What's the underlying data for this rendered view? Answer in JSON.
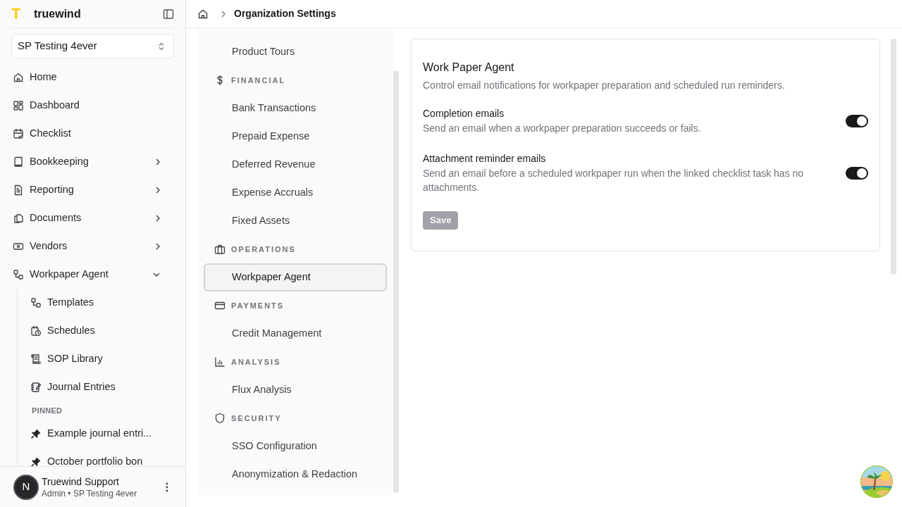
{
  "sidebar": {
    "logo": "T",
    "brand": "truewind",
    "org_selector": {
      "value": "SP Testing 4ever"
    },
    "nav": [
      {
        "label": "Home"
      },
      {
        "label": "Dashboard"
      },
      {
        "label": "Checklist"
      },
      {
        "label": "Bookkeeping",
        "expanded": false
      },
      {
        "label": "Reporting",
        "expanded": false
      },
      {
        "label": "Documents",
        "expanded": false
      },
      {
        "label": "Vendors",
        "expanded": false
      },
      {
        "label": "Workpaper Agent",
        "expanded": true,
        "children": [
          {
            "label": "Templates"
          },
          {
            "label": "Schedules"
          },
          {
            "label": "SOP Library"
          },
          {
            "label": "Journal Entries"
          }
        ]
      }
    ],
    "pinned_title": "PINNED",
    "pinned": [
      {
        "label": "Example journal entri..."
      },
      {
        "label": "October portfolio bon"
      }
    ],
    "user": {
      "initial": "N",
      "name": "Truewind Support",
      "role": "Admin • SP Testing 4ever"
    }
  },
  "breadcrumb": {
    "current": "Organization Settings"
  },
  "settings_nav": [
    {
      "items": [
        {
          "label": "Product Tours",
          "selected": false
        }
      ]
    },
    {
      "title": "FINANCIAL",
      "items": [
        {
          "label": "Bank Transactions",
          "selected": false
        },
        {
          "label": "Prepaid Expense",
          "selected": false
        },
        {
          "label": "Deferred Revenue",
          "selected": false
        },
        {
          "label": "Expense Accruals",
          "selected": false
        },
        {
          "label": "Fixed Assets",
          "selected": false
        }
      ]
    },
    {
      "title": "OPERATIONS",
      "items": [
        {
          "label": "Workpaper Agent",
          "selected": true
        }
      ]
    },
    {
      "title": "PAYMENTS",
      "items": [
        {
          "label": "Credit Management",
          "selected": false
        }
      ]
    },
    {
      "title": "ANALYSIS",
      "items": [
        {
          "label": "Flux Analysis",
          "selected": false
        }
      ]
    },
    {
      "title": "SECURITY",
      "items": [
        {
          "label": "SSO Configuration",
          "selected": false
        },
        {
          "label": "Anonymization & Redaction",
          "selected": false
        }
      ]
    }
  ],
  "panel": {
    "title": "Work Paper Agent",
    "description": "Control email notifications for workpaper preparation and scheduled run reminders.",
    "settings": [
      {
        "label": "Completion emails",
        "description": "Send an email when a workpaper preparation succeeds or fails.",
        "on": true
      },
      {
        "label": "Attachment reminder emails",
        "description": "Send an email before a scheduled workpaper run when the linked checklist task has no attachments.",
        "on": true
      }
    ],
    "save_button": {
      "label": "Save",
      "disabled": true
    }
  }
}
